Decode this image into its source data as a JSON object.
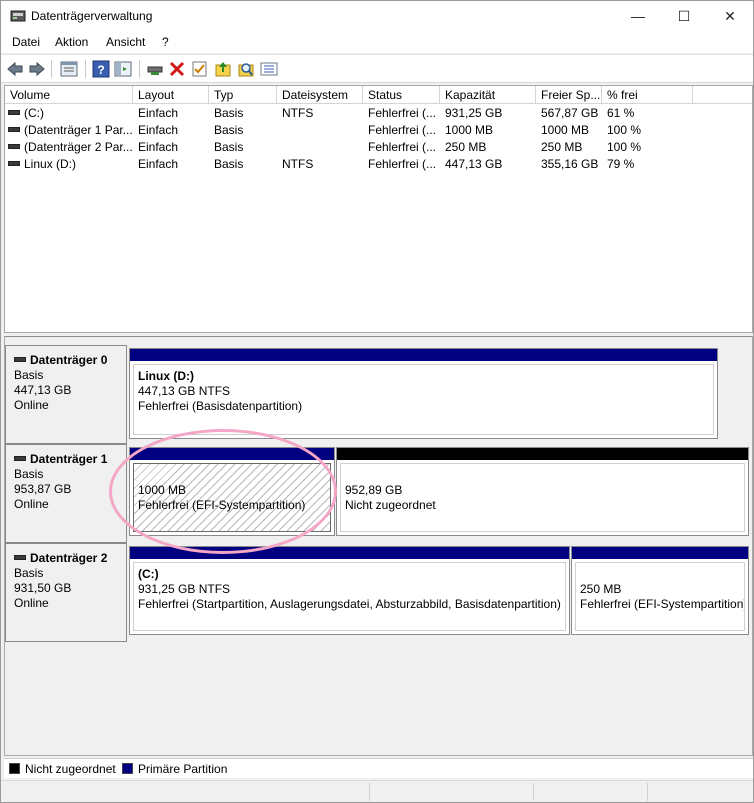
{
  "window": {
    "title": "Datenträgerverwaltung",
    "minimize": "—",
    "maximize": "☐",
    "close": "✕"
  },
  "menu": [
    "Datei",
    "Aktion",
    "Ansicht",
    "?"
  ],
  "toolbar": {
    "icons": [
      "back-icon",
      "forward-icon",
      "properties-icon",
      "help-icon",
      "console-tree-icon",
      "connect-icon",
      "delete-icon",
      "checkmark-icon",
      "import-icon",
      "search-icon",
      "list-icon"
    ]
  },
  "list": {
    "columns": [
      "Volume",
      "Layout",
      "Typ",
      "Dateisystem",
      "Status",
      "Kapazität",
      "Freier Sp...",
      "% frei"
    ],
    "rows": [
      [
        "(C:)",
        "Einfach",
        "Basis",
        "NTFS",
        "Fehlerfrei (...",
        "931,25 GB",
        "567,87 GB",
        "61 %"
      ],
      [
        "(Datenträger 1 Par...",
        "Einfach",
        "Basis",
        "",
        "Fehlerfrei (...",
        "1000 MB",
        "1000 MB",
        "100 %"
      ],
      [
        "(Datenträger 2 Par...",
        "Einfach",
        "Basis",
        "",
        "Fehlerfrei (...",
        "250 MB",
        "250 MB",
        "100 %"
      ],
      [
        "Linux (D:)",
        "Einfach",
        "Basis",
        "NTFS",
        "Fehlerfrei (...",
        "447,13 GB",
        "355,16 GB",
        "79 %"
      ]
    ]
  },
  "disks": [
    {
      "name": "Datenträger 0",
      "type": "Basis",
      "size": "447,13 GB",
      "status": "Online",
      "partitions": [
        {
          "title": "Linux  (D:)",
          "line1": "447,13 GB NTFS",
          "line2": "Fehlerfrei (Basisdatenpartition)"
        }
      ]
    },
    {
      "name": "Datenträger 1",
      "type": "Basis",
      "size": "953,87 GB",
      "status": "Online",
      "partitions": [
        {
          "title": "",
          "line1": "1000 MB",
          "line2": "Fehlerfrei (EFI-Systempartition)"
        },
        {
          "title": "",
          "line1": "952,89 GB",
          "line2": "Nicht zugeordnet"
        }
      ]
    },
    {
      "name": "Datenträger 2",
      "type": "Basis",
      "size": "931,50 GB",
      "status": "Online",
      "partitions": [
        {
          "title": "(C:)",
          "line1": "931,25 GB NTFS",
          "line2": "Fehlerfrei (Startpartition, Auslagerungsdatei, Absturzabbild, Basisdatenpartition)"
        },
        {
          "title": "",
          "line1": "250 MB",
          "line2": "Fehlerfrei (EFI-Systempartition)"
        }
      ]
    }
  ],
  "legend": [
    {
      "label": "Nicht zugeordnet",
      "color": "#000000"
    },
    {
      "label": "Primäre Partition",
      "color": "#000080"
    }
  ],
  "colors": {
    "primary": "#000080",
    "unallocated": "#000000",
    "highlight": "#f4a6c6"
  }
}
